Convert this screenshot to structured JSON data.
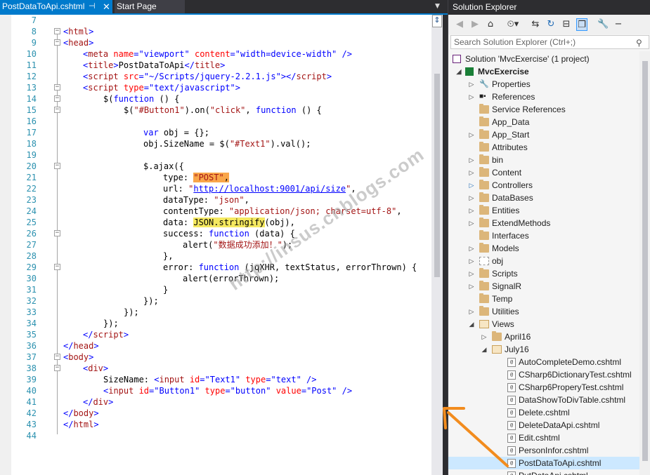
{
  "tabs": {
    "active": {
      "label": "PostDataToApi.cshtml",
      "pin_icon": "pin-icon",
      "close_icon": "close-icon"
    },
    "inactive": {
      "label": "Start Page"
    },
    "overflow_icon": "chevron-down-icon"
  },
  "editor": {
    "watermark": "http://insus.cnblogs.com",
    "line_numbers": [
      "7",
      "8",
      "9",
      "10",
      "11",
      "12",
      "13",
      "14",
      "15",
      "16",
      "17",
      "18",
      "19",
      "20",
      "21",
      "22",
      "23",
      "24",
      "25",
      "26",
      "27",
      "28",
      "29",
      "30",
      "31",
      "32",
      "33",
      "34",
      "35",
      "36",
      "37",
      "38",
      "39",
      "40",
      "41",
      "42",
      "43",
      "44"
    ],
    "code": {
      "l8a": "<",
      "l8b": "html",
      "l8c": ">",
      "l9a": "<",
      "l9b": "head",
      "l9c": ">",
      "l10a": "<",
      "l10b": "meta",
      "l10c": " name",
      "l10d": "=",
      "l10e": "\"viewport\"",
      "l10f": " content",
      "l10g": "=",
      "l10h": "\"width=device-width\"",
      "l10i": " />",
      "l11a": "<",
      "l11b": "title",
      "l11c": ">",
      "l11d": "PostDataToApi",
      "l11e": "</",
      "l11f": "title",
      "l11g": ">",
      "l12a": "<",
      "l12b": "script",
      "l12c": " src",
      "l12d": "=",
      "l12e": "\"~/Scripts/jquery-2.2.1.js\"",
      "l12f": "></",
      "l12g": "script",
      "l12h": ">",
      "l13a": "<",
      "l13b": "script",
      "l13c": " type",
      "l13d": "=",
      "l13e": "\"text/javascript\"",
      "l13f": ">",
      "l14a": "$(",
      "l14b": "function",
      "l14c": " () {",
      "l15a": "$(",
      "l15b": "\"#Button1\"",
      "l15c": ").on(",
      "l15d": "\"click\"",
      "l15e": ", ",
      "l15f": "function",
      "l15g": " () {",
      "l17a": "var",
      "l17b": " obj = {};",
      "l18a": "obj.SizeName = $(",
      "l18b": "\"#Text1\"",
      "l18c": ").val();",
      "l20a": "$.ajax({",
      "l21a": "type: ",
      "l21b": "\"POST\"",
      "l21c": ",",
      "l22a": "url: ",
      "l22b": "\"",
      "l22c": "http://localhost:9001/api/size",
      "l22d": "\"",
      "l22e": ",",
      "l23a": "dataType: ",
      "l23b": "\"json\"",
      "l23c": ",",
      "l24a": "contentType: ",
      "l24b": "\"application/json; charset=utf-8\"",
      "l24c": ",",
      "l25a": "data: ",
      "l25b": "JSON.stringify",
      "l25c": "(obj),",
      "l26a": "success: ",
      "l26b": "function",
      "l26c": " (data) {",
      "l27a": "alert(",
      "l27b": "\"数据成功添加！\"",
      "l27c": ");",
      "l28a": "},",
      "l29a": "error: ",
      "l29b": "function",
      "l29c": " (jqXHR, textStatus, errorThrown) {",
      "l30a": "alert(errorThrown);",
      "l31a": "}",
      "l32a": "});",
      "l33a": "});",
      "l34a": "});",
      "l35a": "</",
      "l35b": "script",
      "l35c": ">",
      "l36a": "</",
      "l36b": "head",
      "l36c": ">",
      "l37a": "<",
      "l37b": "body",
      "l37c": ">",
      "l38a": "<",
      "l38b": "div",
      "l38c": ">",
      "l39a": "SizeName: ",
      "l39b": "<",
      "l39c": "input",
      "l39d": " id",
      "l39e": "=",
      "l39f": "\"Text1\"",
      "l39g": " type",
      "l39h": "=",
      "l39i": "\"text\"",
      "l39j": " />",
      "l40a": "<",
      "l40b": "input",
      "l40c": " id",
      "l40d": "=",
      "l40e": "\"Button1\"",
      "l40f": " type",
      "l40g": "=",
      "l40h": "\"button\"",
      "l40i": " value",
      "l40j": "=",
      "l40k": "\"Post\"",
      "l40l": " />",
      "l41a": "</",
      "l41b": "div",
      "l41c": ">",
      "l42a": "</",
      "l42b": "body",
      "l42c": ">",
      "l43a": "</",
      "l43b": "html",
      "l43c": ">"
    }
  },
  "solution_explorer": {
    "title": "Solution Explorer",
    "search_placeholder": "Search Solution Explorer (Ctrl+;)",
    "tree": {
      "solution": "Solution 'MvcExercise' (1 project)",
      "project": "MvcExercise",
      "properties": "Properties",
      "references": "References",
      "service_references": "Service References",
      "app_data": "App_Data",
      "app_start": "App_Start",
      "attributes": "Attributes",
      "bin": "bin",
      "content": "Content",
      "controllers": "Controllers",
      "databases": "DataBases",
      "entities": "Entities",
      "extend_methods": "ExtendMethods",
      "interfaces": "Interfaces",
      "models": "Models",
      "obj": "obj",
      "scripts": "Scripts",
      "signalr": "SignalR",
      "temp": "Temp",
      "utilities": "Utilities",
      "views": "Views",
      "april16": "April16",
      "july16": "July16",
      "f1": "AutoCompleteDemo.cshtml",
      "f2": "CSharp6DictionaryTest.cshtml",
      "f3": "CSharp6ProperyTest.cshtml",
      "f4": "DataShowToDivTable.cshtml",
      "f5": "Delete.cshtml",
      "f6": "DeleteDataApi.cshtml",
      "f7": "Edit.cshtml",
      "f8": "PersonInfor.cshtml",
      "f9": "PostDataToApi.cshtml",
      "f10": "PutDataApi.cshtml"
    }
  }
}
